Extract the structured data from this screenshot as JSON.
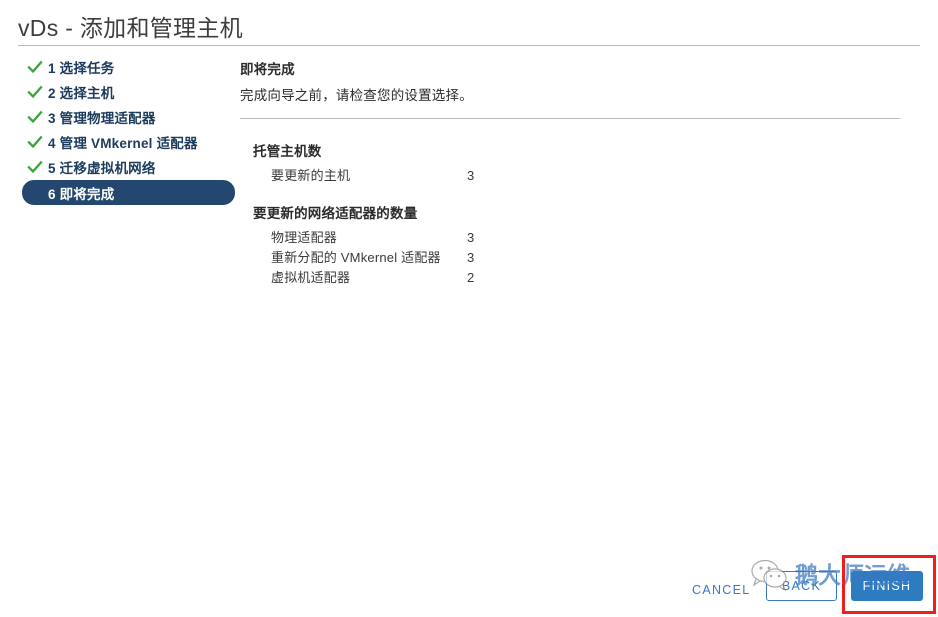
{
  "header": {
    "title": "vDs - 添加和管理主机"
  },
  "steps": [
    {
      "number": "1",
      "label": "1 选择任务",
      "state": "done"
    },
    {
      "number": "2",
      "label": "2 选择主机",
      "state": "done"
    },
    {
      "number": "3",
      "label": "3 管理物理适配器",
      "state": "done"
    },
    {
      "number": "4",
      "label": "4 管理 VMkernel 适配器",
      "state": "done"
    },
    {
      "number": "5",
      "label": "5 迁移虚拟机网络",
      "state": "done"
    },
    {
      "number": "6",
      "label": "6 即将完成",
      "state": "active"
    }
  ],
  "content": {
    "heading": "即将完成",
    "subtitle": "完成向导之前，请检查您的设置选择。",
    "groups": [
      {
        "title": "托管主机数",
        "rows": [
          {
            "label": "要更新的主机",
            "value": "3"
          }
        ]
      },
      {
        "title": "要更新的网络适配器的数量",
        "rows": [
          {
            "label": "物理适配器",
            "value": "3"
          },
          {
            "label": "重新分配的 VMkernel 适配器",
            "value": "3"
          },
          {
            "label": "虚拟机适配器",
            "value": "2"
          }
        ]
      }
    ]
  },
  "footer": {
    "cancel_label": "CANCEL",
    "back_label": "BACK",
    "finish_label": "FINISH"
  },
  "watermark": {
    "text": "鹅大师运维",
    "logo": "wechat-icon"
  },
  "colors": {
    "accent_blue": "#3b78c3",
    "primary_button": "#2e7cc0",
    "active_step": "#23476e",
    "check_green": "#3aa33a",
    "highlight_red": "#f01d1d"
  }
}
